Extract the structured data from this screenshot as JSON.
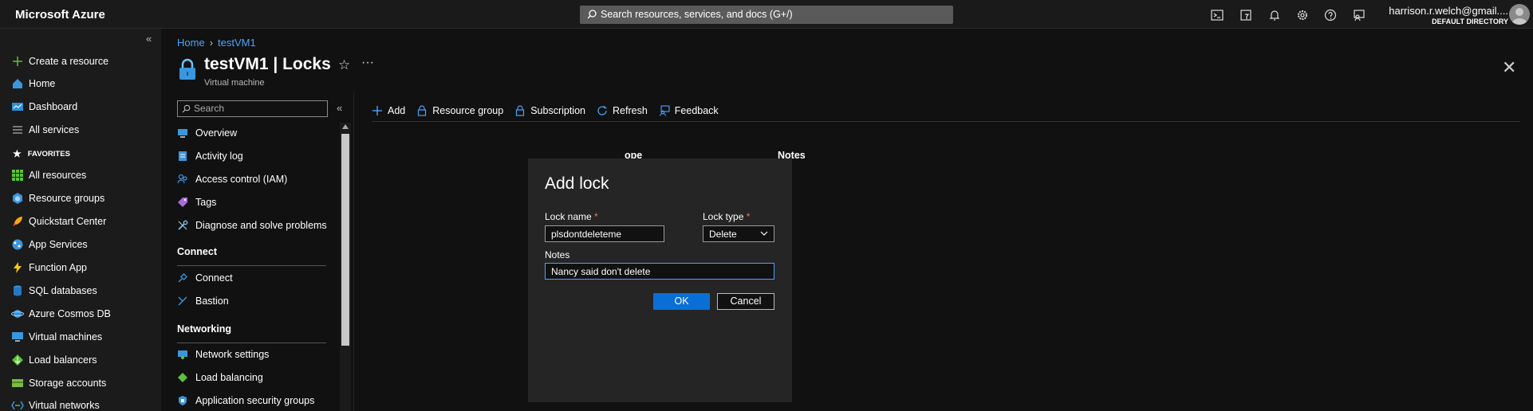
{
  "app": {
    "brand": "Microsoft Azure",
    "search_text": "Search resources, services, and docs (G+/)",
    "user_name": "harrison.r.welch@gmail....",
    "directory": "DEFAULT DIRECTORY"
  },
  "leftnav": {
    "top_items": [
      {
        "label": "Create a resource",
        "icon": "plus-icon"
      },
      {
        "label": "Home",
        "icon": "home-icon"
      },
      {
        "label": "Dashboard",
        "icon": "dashboard-icon"
      },
      {
        "label": "All services",
        "icon": "list-icon"
      }
    ],
    "favorites_label": "FAVORITES",
    "favorites": [
      {
        "label": "All resources",
        "icon": "grid-icon"
      },
      {
        "label": "Resource groups",
        "icon": "cube-icon"
      },
      {
        "label": "Quickstart Center",
        "icon": "rocket-icon"
      },
      {
        "label": "App Services",
        "icon": "globe-icon"
      },
      {
        "label": "Function App",
        "icon": "bolt-icon"
      },
      {
        "label": "SQL databases",
        "icon": "database-icon"
      },
      {
        "label": "Azure Cosmos DB",
        "icon": "planet-icon"
      },
      {
        "label": "Virtual machines",
        "icon": "monitor-icon"
      },
      {
        "label": "Load balancers",
        "icon": "diamond-icon"
      },
      {
        "label": "Storage accounts",
        "icon": "storage-icon"
      },
      {
        "label": "Virtual networks",
        "icon": "network-icon"
      }
    ]
  },
  "breadcrumb": {
    "home": "Home",
    "current": "testVM1"
  },
  "page": {
    "title": "testVM1 | Locks",
    "subtitle": "Virtual machine"
  },
  "resource_menu": {
    "search_placeholder": "Search",
    "items": [
      {
        "label": "Overview",
        "icon": "monitor-icon"
      },
      {
        "label": "Activity log",
        "icon": "log-icon"
      },
      {
        "label": "Access control (IAM)",
        "icon": "people-icon"
      },
      {
        "label": "Tags",
        "icon": "tag-icon"
      },
      {
        "label": "Diagnose and solve problems",
        "icon": "wrench-icon"
      }
    ],
    "sections": [
      {
        "title": "Connect",
        "items": [
          {
            "label": "Connect",
            "icon": "plug-icon"
          },
          {
            "label": "Bastion",
            "icon": "bastion-icon"
          }
        ]
      },
      {
        "title": "Networking",
        "items": [
          {
            "label": "Network settings",
            "icon": "network-settings-icon"
          },
          {
            "label": "Load balancing",
            "icon": "diamond-icon"
          },
          {
            "label": "Application security groups",
            "icon": "shield-icon"
          }
        ]
      }
    ]
  },
  "toolbar": {
    "add": "Add",
    "resource_group": "Resource group",
    "subscription": "Subscription",
    "refresh": "Refresh",
    "feedback": "Feedback"
  },
  "table": {
    "col_scope": "ope",
    "col_notes": "Notes"
  },
  "add_lock": {
    "title": "Add lock",
    "lock_name_label": "Lock name",
    "lock_name_value": "plsdontdeleteme",
    "lock_type_label": "Lock type",
    "lock_type_value": "Delete",
    "notes_label": "Notes",
    "notes_value": "Nancy said don't delete",
    "required_mark": "*",
    "ok": "OK",
    "cancel": "Cancel"
  },
  "colors": {
    "accent": "#0a6fd4",
    "link": "#4aa3ff",
    "required": "#ff6e6e"
  }
}
